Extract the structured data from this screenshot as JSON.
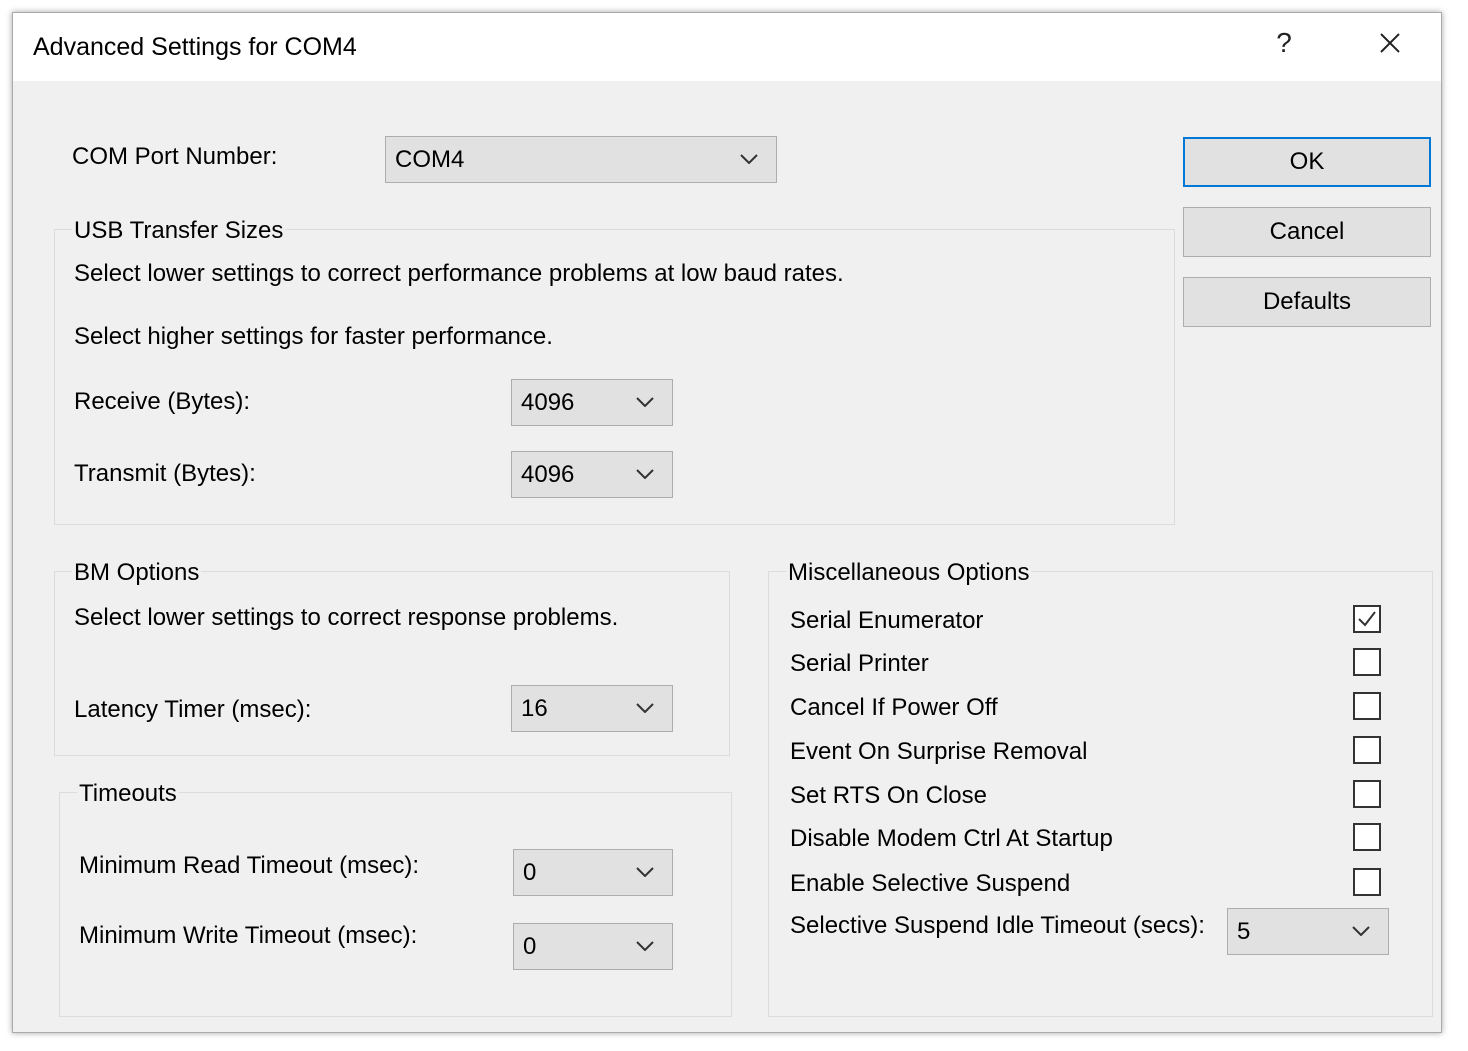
{
  "window": {
    "title": "Advanced Settings for COM4",
    "help_label": "?",
    "close_label": "✕"
  },
  "com_port": {
    "label": "COM Port Number:",
    "value": "COM4"
  },
  "buttons": {
    "ok": "OK",
    "cancel": "Cancel",
    "defaults": "Defaults"
  },
  "usb_transfer": {
    "title": "USB Transfer Sizes",
    "desc_lower": "Select lower settings to correct performance problems at low baud rates.",
    "desc_higher": "Select higher settings for faster performance.",
    "receive_label": "Receive (Bytes):",
    "receive_value": "4096",
    "transmit_label": "Transmit (Bytes):",
    "transmit_value": "4096"
  },
  "bm_options": {
    "title": "BM Options",
    "desc": "Select lower settings to correct response problems.",
    "latency_label": "Latency Timer (msec):",
    "latency_value": "16"
  },
  "timeouts": {
    "title": "Timeouts",
    "min_read_label": "Minimum Read Timeout (msec):",
    "min_read_value": "0",
    "min_write_label": "Minimum Write Timeout (msec):",
    "min_write_value": "0"
  },
  "misc": {
    "title": "Miscellaneous Options",
    "options": [
      {
        "label": "Serial Enumerator",
        "checked": true
      },
      {
        "label": "Serial Printer",
        "checked": false
      },
      {
        "label": "Cancel If Power Off",
        "checked": false
      },
      {
        "label": "Event On Surprise Removal",
        "checked": false
      },
      {
        "label": "Set RTS On Close",
        "checked": false
      },
      {
        "label": "Disable Modem Ctrl At Startup",
        "checked": false
      },
      {
        "label": "Enable Selective Suspend",
        "checked": false
      }
    ],
    "idle_timeout_label": "Selective Suspend Idle Timeout (secs):",
    "idle_timeout_value": "5"
  },
  "colors": {
    "dialog_bg": "#f0f0f0",
    "default_button_border": "#0078d7"
  }
}
